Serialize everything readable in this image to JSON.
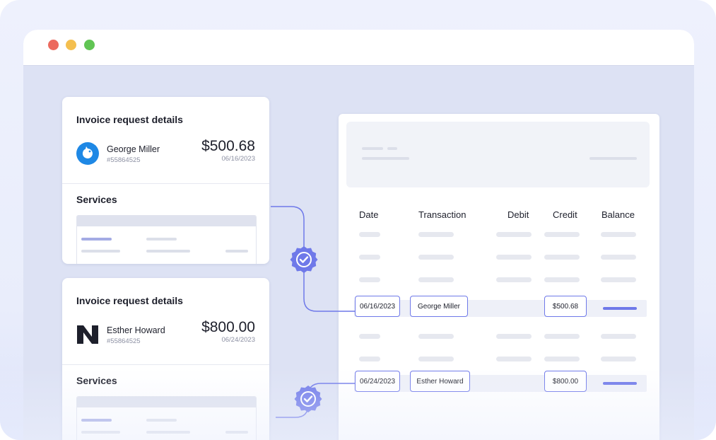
{
  "window": {
    "controls": [
      "close",
      "minimize",
      "maximize"
    ]
  },
  "invoices": [
    {
      "title": "Invoice request details",
      "name": "George Miller",
      "id": "#55864525",
      "amount": "$500.68",
      "date": "06/16/2023",
      "services_label": "Services",
      "logo_icon": "blue-bird-logo-icon"
    },
    {
      "title": "Invoice request details",
      "name": "Esther Howard",
      "id": "#55864525",
      "amount": "$800.00",
      "date": "06/24/2023",
      "services_label": "Services",
      "logo_icon": "n-letter-logo-icon"
    }
  ],
  "ledger": {
    "columns": [
      "Date",
      "Transaction",
      "Debit",
      "Credit",
      "Balance"
    ],
    "matched_rows": [
      {
        "date": "06/16/2023",
        "transaction": "George Miller",
        "credit": "$500.68"
      },
      {
        "date": "06/24/2023",
        "transaction": "Esther Howard",
        "credit": "$800.00"
      }
    ]
  },
  "colors": {
    "accent": "#6f79e9",
    "badge": "#6f79e9",
    "logo_blue": "#1e88e5",
    "traffic_red": "#ec6a5e",
    "traffic_yellow": "#f4bf4f",
    "traffic_green": "#61c554"
  },
  "icons": [
    "verified-badge-icon",
    "verified-badge-icon"
  ]
}
